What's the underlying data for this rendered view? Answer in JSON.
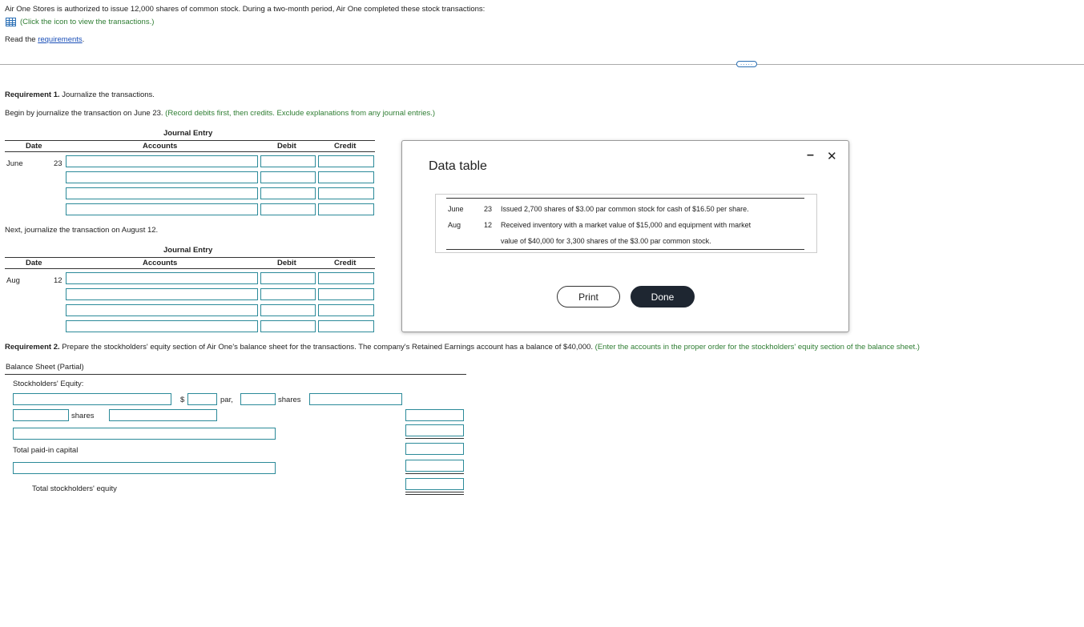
{
  "intro": {
    "line1": "Air One Stores is authorized to issue 12,000 shares of common stock. During a two-month period, Air One completed these stock transactions:",
    "click_icon_text": "(Click the icon to view the transactions.)",
    "read_prefix": "Read the ",
    "requirements_link": "requirements",
    "read_suffix": "."
  },
  "divider": {
    "ellipsis": "....."
  },
  "req1": {
    "label": "Requirement 1.",
    "text": " Journalize the transactions.",
    "begin_text": "Begin by journalize the transaction on June 23.",
    "begin_hint": "(Record debits first, then credits. Exclude explanations from any journal entries.)",
    "next_text": "Next, journalize the transaction on August 12."
  },
  "journal": {
    "title": "Journal Entry",
    "col_date": "Date",
    "col_accounts": "Accounts",
    "col_debit": "Debit",
    "col_credit": "Credit",
    "entry1": {
      "month": "June",
      "day": "23"
    },
    "entry2": {
      "month": "Aug",
      "day": "12"
    }
  },
  "req2": {
    "label": "Requirement 2.",
    "text": " Prepare the stockholders' equity section of Air One's balance sheet for the transactions. The company's Retained Earnings account has a balance of $40,000.",
    "hint": "(Enter the accounts in the proper order for the stockholders' equity section of the balance sheet.)"
  },
  "balance_sheet": {
    "title": "Balance Sheet (Partial)",
    "section": "Stockholders' Equity:",
    "dollar": "$",
    "par": "par,",
    "shares": "shares",
    "shares2": "shares",
    "total_paid_in": "Total paid-in capital",
    "total_equity": "Total stockholders' equity"
  },
  "modal": {
    "title": "Data table",
    "minimize": "–",
    "close": "✕",
    "rows": [
      {
        "month": "June",
        "day": "23",
        "text": "Issued 2,700 shares of $3.00 par common stock for cash of $16.50 per share."
      },
      {
        "month": "Aug",
        "day": "12",
        "text": "Received inventory with a market value of $15,000 and equipment with market",
        "text2": "value of $40,000 for 3,300 shares of the $3.00 par common stock."
      }
    ],
    "print_label": "Print",
    "done_label": "Done"
  },
  "colors": {
    "input_border": "#2b8a99",
    "hint_green": "#2e7d32",
    "link_blue": "#1a4fb8",
    "done_bg": "#1e2631"
  }
}
